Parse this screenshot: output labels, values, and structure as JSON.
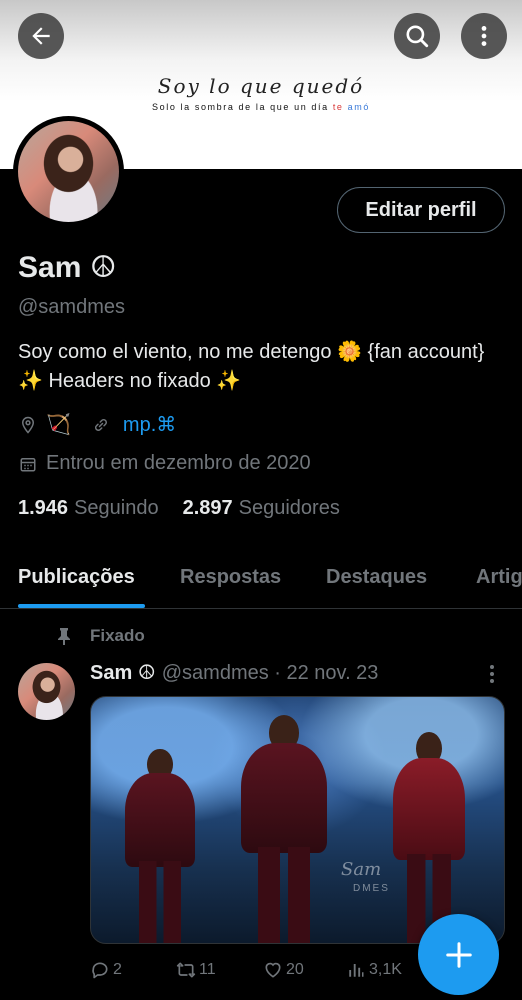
{
  "banner": {
    "title": "Soy lo que quedó",
    "subtitle_pre": "Solo la sombra de la que un día ",
    "subtitle_red": "te",
    "subtitle_blue": "amó"
  },
  "profile": {
    "edit_button": "Editar perfil",
    "name": "Sam ☮",
    "handle": "@samdmes",
    "bio": "Soy como el viento, no me detengo 🌼 {fan account} ✨ Headers no fixado ✨",
    "location": "🏹",
    "link": "mp.⌘",
    "joined": "Entrou em dezembro de 2020"
  },
  "stats": {
    "following_count": "1.946",
    "following_label": "Seguindo",
    "followers_count": "2.897",
    "followers_label": "Seguidores"
  },
  "tabs": [
    {
      "label": "Publicações"
    },
    {
      "label": "Respostas"
    },
    {
      "label": "Destaques"
    },
    {
      "label": "Artigos"
    }
  ],
  "post": {
    "pinned_label": "Fixado",
    "author_name": "Sam ☮",
    "author_handle": "@samdmes · 22 nov. 23",
    "watermark": "Sam",
    "watermark2": "DMES",
    "replies": "2",
    "reposts": "11",
    "likes": "20",
    "views": "3,1K"
  },
  "colors": {
    "accent": "#1d9bf0",
    "muted": "#71767b",
    "text": "#e7e9ea",
    "background": "#000000"
  },
  "icons": {
    "back": "arrow-left-icon",
    "search": "search-icon",
    "more": "more-vertical-icon",
    "location": "location-pin-icon",
    "link": "link-icon",
    "calendar": "calendar-icon",
    "pin": "pin-icon",
    "reply": "reply-icon",
    "repost": "repost-icon",
    "like": "heart-icon",
    "views": "views-icon",
    "compose": "plus-icon"
  }
}
